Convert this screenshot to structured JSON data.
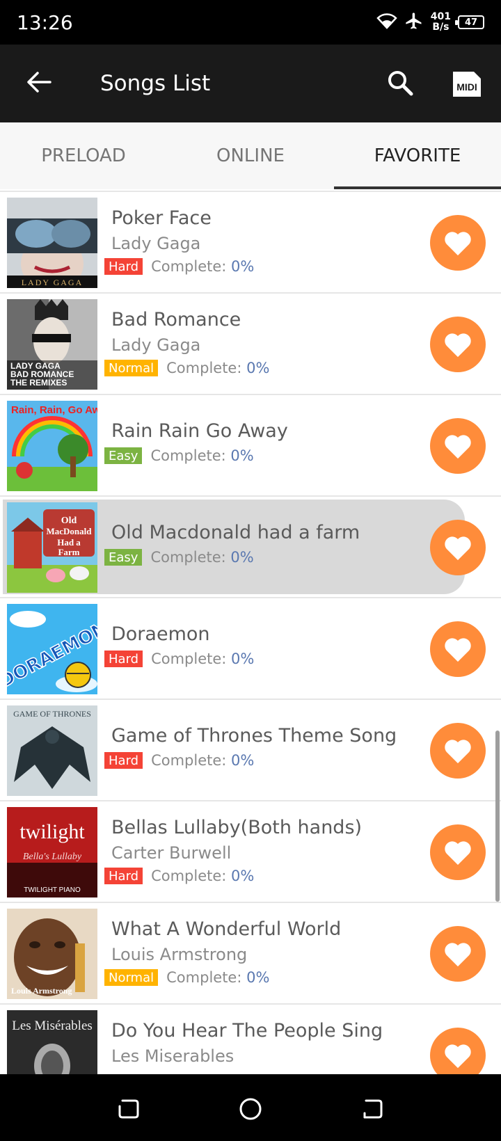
{
  "status_bar": {
    "time": "13:26",
    "net_speed_value": "401",
    "net_speed_unit": "B/s",
    "battery": "47"
  },
  "toolbar": {
    "title": "Songs List",
    "midi_label": "MIDI"
  },
  "tabs": [
    {
      "label": "PRELOAD",
      "active": false
    },
    {
      "label": "ONLINE",
      "active": false
    },
    {
      "label": "FAVORITE",
      "active": true
    }
  ],
  "complete_label": "Complete: ",
  "songs": [
    {
      "title": "Poker Face",
      "artist": "Lady Gaga",
      "difficulty": "Hard",
      "complete": "0%",
      "cover_text": "LADY GAGA"
    },
    {
      "title": "Bad Romance",
      "artist": "Lady Gaga",
      "difficulty": "Normal",
      "complete": "0%",
      "cover_text": "LADY GAGA BAD ROMANCE THE REMIXES"
    },
    {
      "title": "Rain Rain Go Away",
      "artist": "",
      "difficulty": "Easy",
      "complete": "0%",
      "cover_text": "Rain, Rain, Go Away"
    },
    {
      "title": "Old Macdonald had a farm",
      "artist": "",
      "difficulty": "Easy",
      "complete": "0%",
      "cover_text": "Old MacDonald Had a Farm"
    },
    {
      "title": "Doraemon",
      "artist": "",
      "difficulty": "Hard",
      "complete": "0%",
      "cover_text": "DORAEMON"
    },
    {
      "title": "Game of Thrones Theme Song",
      "artist": "",
      "difficulty": "Hard",
      "complete": "0%",
      "cover_text": "GAME OF THRONES"
    },
    {
      "title": "Bellas Lullaby(Both hands)",
      "artist": "Carter Burwell",
      "difficulty": "Hard",
      "complete": "0%",
      "cover_text": "twilight"
    },
    {
      "title": "What A Wonderful World",
      "artist": "Louis Armstrong",
      "difficulty": "Normal",
      "complete": "0%",
      "cover_text": "Louis Armstrong"
    },
    {
      "title": "Do You Hear The People Sing",
      "artist": "Les Miserables",
      "difficulty": "",
      "complete": "",
      "cover_text": "Les Misérables"
    }
  ],
  "colors": {
    "hard": "#f44336",
    "normal": "#ffb300",
    "easy": "#7cb342",
    "favorite": "#ff8c3a"
  }
}
